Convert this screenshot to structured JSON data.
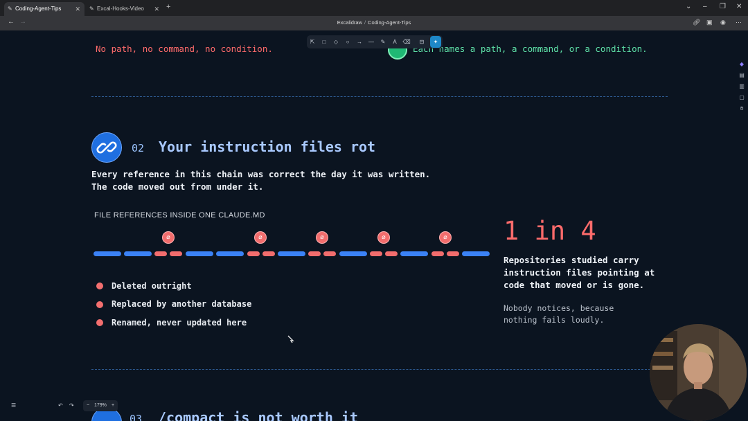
{
  "browser": {
    "tabs": [
      {
        "label": "Coding-Agent-Tips",
        "active": true
      },
      {
        "label": "Excal-Hooks-Video",
        "active": false
      }
    ],
    "breadcrumb": {
      "workspace": "Excalidraw",
      "separator": "/",
      "page": "Coding-Agent-Tips"
    }
  },
  "canvas": {
    "top_left_text": "No path, no command, no condition.",
    "top_right_text": "Each names a path, a command, or a condition.",
    "section2": {
      "number": "02",
      "title": "Your instruction files rot",
      "subtitle_line1": "Every reference in this chain was correct the day it was written.",
      "subtitle_line2": "The code moved out from under it.",
      "chain_label": "FILE REFERENCES INSIDE ONE CLAUDE.MD",
      "bullets": [
        "Deleted outright",
        "Replaced by another database",
        "Renamed, never updated here"
      ],
      "stat": "1 in 4",
      "stat_line1": "Repositories studied carry",
      "stat_line2": "instruction files pointing at",
      "stat_line3": "code that moved or is gone.",
      "note_line1": "Nobody notices, because",
      "note_line2": "nothing fails loudly."
    },
    "section3": {
      "number": "03",
      "title": "/compact is not worth it"
    },
    "zoom": "179%"
  },
  "colors": {
    "background": "#0b1420",
    "accent_blue": "#3b82f6",
    "accent_red": "#f26d6d",
    "accent_green": "#3ecf8e",
    "title_blue": "#9cc4ff"
  }
}
